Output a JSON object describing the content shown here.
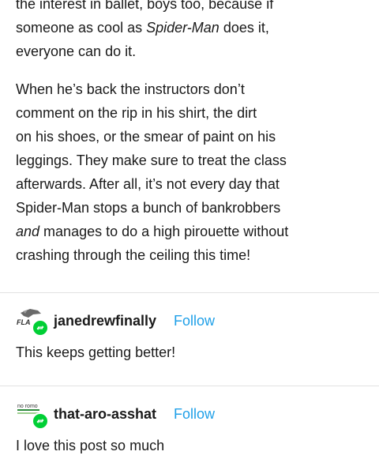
{
  "post": {
    "clipped_line": "the interest in ballet, boys too, because if",
    "paragraph1": [
      {
        "parts": [
          {
            "text": "someone as cool as "
          },
          {
            "text": "Spider-Man",
            "italic": true
          },
          {
            "text": " does it,"
          }
        ]
      },
      {
        "parts": [
          {
            "text": "everyone can do it."
          }
        ]
      }
    ],
    "paragraph2": [
      {
        "parts": [
          {
            "text": "When he’s back the instructors don’t"
          }
        ]
      },
      {
        "parts": [
          {
            "text": "comment on the rip in his shirt, the dirt"
          }
        ]
      },
      {
        "parts": [
          {
            "text": "on his shoes, or the smear of paint on his"
          }
        ]
      },
      {
        "parts": [
          {
            "text": "leggings. They make sure to treat the class"
          }
        ]
      },
      {
        "parts": [
          {
            "text": "afterwards. After all, it’s not every day that"
          }
        ]
      },
      {
        "parts": [
          {
            "text": "Spider-Man stops a bunch of bankrobbers"
          }
        ]
      },
      {
        "parts": [
          {
            "text": "and",
            "italic": true
          },
          {
            "text": " manages to do a high pirouette without"
          }
        ]
      },
      {
        "parts": [
          {
            "text": "crashing through the ceiling this time!"
          }
        ]
      }
    ]
  },
  "reblogs": [
    {
      "username": "janedrewfinally",
      "follow_label": "Follow",
      "text": "This keeps getting better!",
      "avatar_text": "FLA"
    },
    {
      "username": "that-aro-asshat",
      "follow_label": "Follow",
      "text": "I love this post so much",
      "avatar_text": "no romo"
    }
  ],
  "colors": {
    "follow": "#20a0e8",
    "reblog_badge": "#00cf35",
    "divider": "#e2e2e2"
  },
  "icons": {
    "reblog_badge": "reblog-icon"
  }
}
